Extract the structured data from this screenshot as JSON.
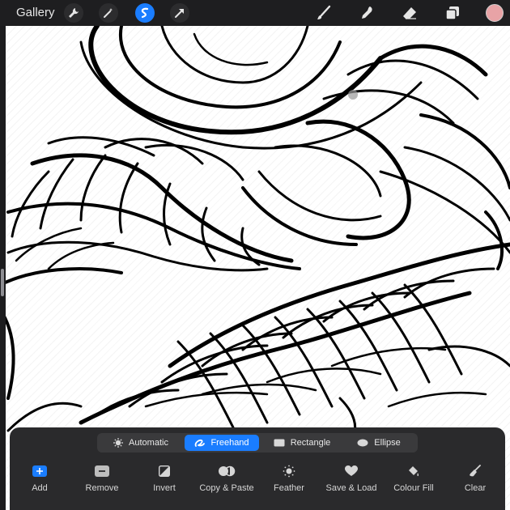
{
  "topbar": {
    "gallery_label": "Gallery",
    "tools": [
      "wrench-icon",
      "magic-wand-icon",
      "selection-icon",
      "transform-arrow-icon",
      "brush-icon",
      "smudge-icon",
      "eraser-icon",
      "layers-icon"
    ],
    "active_tool": "selection-icon",
    "current_color": "#e8a3a6"
  },
  "selection_panel": {
    "modes": [
      {
        "label": "Automatic",
        "icon": "automatic-star-icon"
      },
      {
        "label": "Freehand",
        "icon": "freehand-icon"
      },
      {
        "label": "Rectangle",
        "icon": "rectangle-icon"
      },
      {
        "label": "Ellipse",
        "icon": "ellipse-icon"
      }
    ],
    "active_mode": "Freehand",
    "actions": [
      {
        "label": "Add",
        "icon": "add-icon"
      },
      {
        "label": "Remove",
        "icon": "remove-icon"
      },
      {
        "label": "Invert",
        "icon": "invert-icon"
      },
      {
        "label": "Copy & Paste",
        "icon": "copy-paste-icon"
      },
      {
        "label": "Feather",
        "icon": "feather-icon"
      },
      {
        "label": "Save & Load",
        "icon": "heart-icon"
      },
      {
        "label": "Colour Fill",
        "icon": "colour-fill-icon"
      },
      {
        "label": "Clear",
        "icon": "clear-icon"
      }
    ]
  },
  "colors": {
    "accent": "#1a7dff",
    "toolbar_bg": "#1e1e20",
    "panel_bg": "#2a2a2c"
  }
}
